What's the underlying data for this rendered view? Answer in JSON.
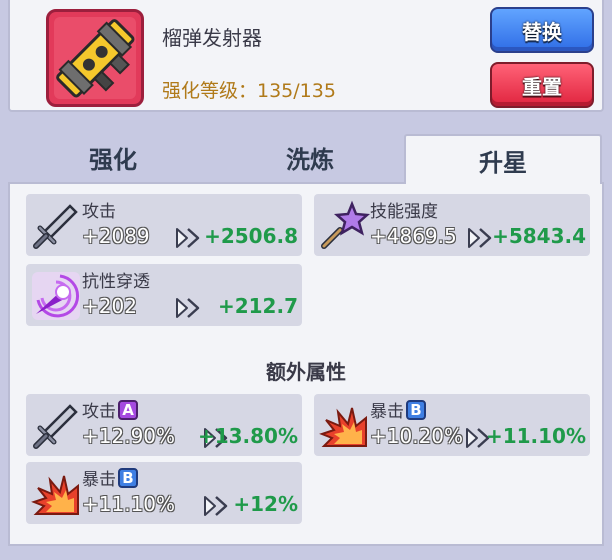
{
  "header": {
    "item_name": "榴弹发射器",
    "level_label": "强化等级：135/135",
    "replace_label": "替换",
    "reset_label": "重置",
    "item_icon": "grenade-launcher-icon"
  },
  "tabs": [
    {
      "label": "强化",
      "active": false
    },
    {
      "label": "洗炼",
      "active": false
    },
    {
      "label": "升星",
      "active": true
    }
  ],
  "stats": [
    {
      "label": "攻击",
      "old": "+2089",
      "new": "+2506.8",
      "icon": "sword-icon"
    },
    {
      "label": "技能强度",
      "old": "+4869.5",
      "new": "+5843.4",
      "icon": "star-wand-icon"
    },
    {
      "label": "抗性穿透",
      "old": "+202",
      "new": "+212.7",
      "icon": "piercing-orb-icon"
    }
  ],
  "extra_title": "额外属性",
  "extra": [
    {
      "label": "攻击",
      "grade": "A",
      "old": "+12.90%",
      "new": "+13.80%",
      "icon": "sword-icon"
    },
    {
      "label": "暴击",
      "grade": "B",
      "old": "+10.20%",
      "new": "+11.10%",
      "icon": "critical-burst-icon"
    },
    {
      "label": "暴击",
      "grade": "B",
      "old": "+11.10%",
      "new": "+12%",
      "icon": "critical-burst-icon"
    }
  ],
  "colors": {
    "value_increase": "#1f9a4a",
    "level_text": "#b07a1a",
    "grade_A": "#a54be0",
    "grade_B": "#3f7fe3",
    "replace_button": "#3b82f6",
    "reset_button": "#e8304a"
  }
}
